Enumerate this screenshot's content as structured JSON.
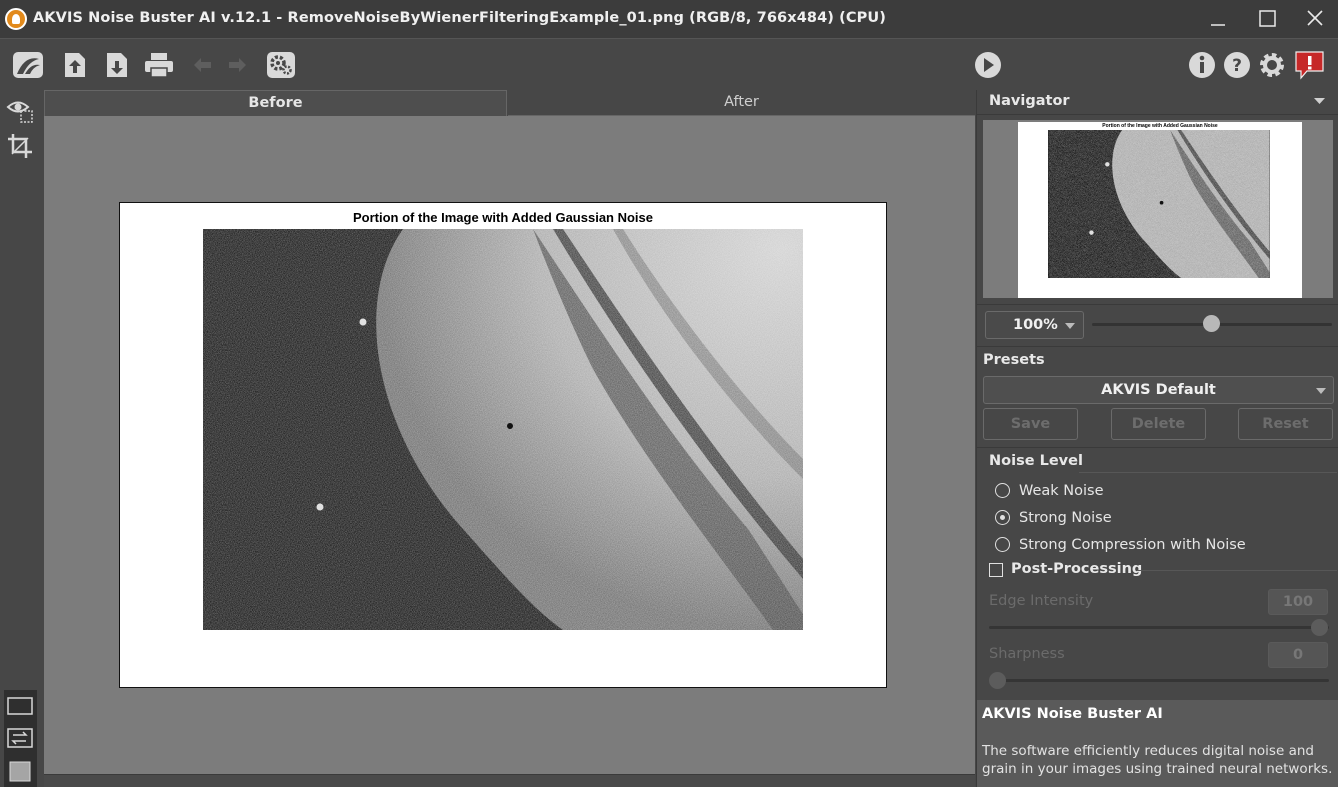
{
  "window": {
    "title": "AKVIS Noise Buster AI v.12.1 - RemoveNoiseByWienerFilteringExample_01.png (RGB/8, 766x484) (CPU)"
  },
  "toolbar": {
    "left_icons": [
      "akvis-logo-icon",
      "open-file-icon",
      "save-file-icon",
      "print-icon",
      "undo-icon",
      "redo-icon",
      "preferences-gear-icon"
    ],
    "right_icons": [
      "run-icon",
      "about-info-icon",
      "help-icon",
      "settings-gear-icon",
      "feedback-alert-icon"
    ]
  },
  "tabs": {
    "before": "Before",
    "after": "After"
  },
  "image": {
    "title": "Portion of the Image with Added Gaussian Noise"
  },
  "navigator": {
    "header": "Navigator",
    "zoom": "100%",
    "zoom_slider_fraction": 0.5
  },
  "presets": {
    "header": "Presets",
    "selected": "AKVIS Default",
    "save": "Save",
    "delete": "Delete",
    "reset": "Reset"
  },
  "noise_level": {
    "header": "Noise Level",
    "options": [
      "Weak Noise",
      "Strong Noise",
      "Strong Compression with Noise"
    ],
    "selected_index": 1
  },
  "post_processing": {
    "label": "Post-Processing",
    "checked": false,
    "edge_intensity_label": "Edge Intensity",
    "edge_intensity_value": "100",
    "sharpness_label": "Sharpness",
    "sharpness_value": "0"
  },
  "info": {
    "name": "AKVIS Noise Buster AI",
    "description": "The software efficiently reduces digital noise and grain in your images using trained neural networks."
  },
  "colors": {
    "background": "#474747",
    "canvas": "#7c7c7c",
    "info_panel": "#5a5a5a",
    "feedback_red": "#c62828"
  }
}
